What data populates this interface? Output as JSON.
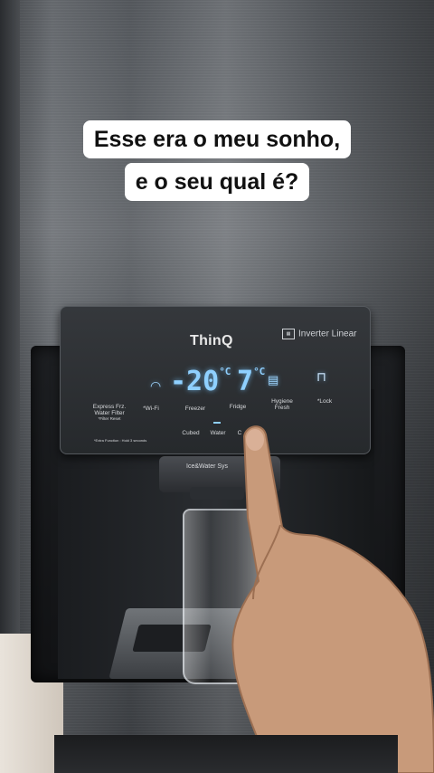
{
  "caption": {
    "line1": "Esse era o meu sonho,",
    "line2": "e o seu qual é?"
  },
  "panel": {
    "brand": "ThinQ",
    "inverter_label": "Inverter Linear",
    "freezer_temp": "-20",
    "fridge_temp": "7",
    "unit": "°C",
    "buttons": {
      "express_frz": "Express Frz.",
      "water_filter": "Water Filter",
      "filter_reset": "*Filter Reset",
      "wifi": "*Wi-Fi",
      "freezer": "Freezer",
      "fridge": "Fridge",
      "hygiene_fresh": "Hygiene\nFresh",
      "lock": "*Lock",
      "cubed": "Cubed",
      "water": "Water",
      "crushed": "C",
      "footnote": "*Extra Function : Hold 3 seconds"
    }
  },
  "dispenser": {
    "label": "Ice&Water Sys"
  },
  "icons": [
    "wifi-icon",
    "lock-icon",
    "filter-icon",
    "inverter-icon"
  ],
  "colors": {
    "display_blue": "#8fd0ff",
    "caption_bg": "#ffffff"
  }
}
